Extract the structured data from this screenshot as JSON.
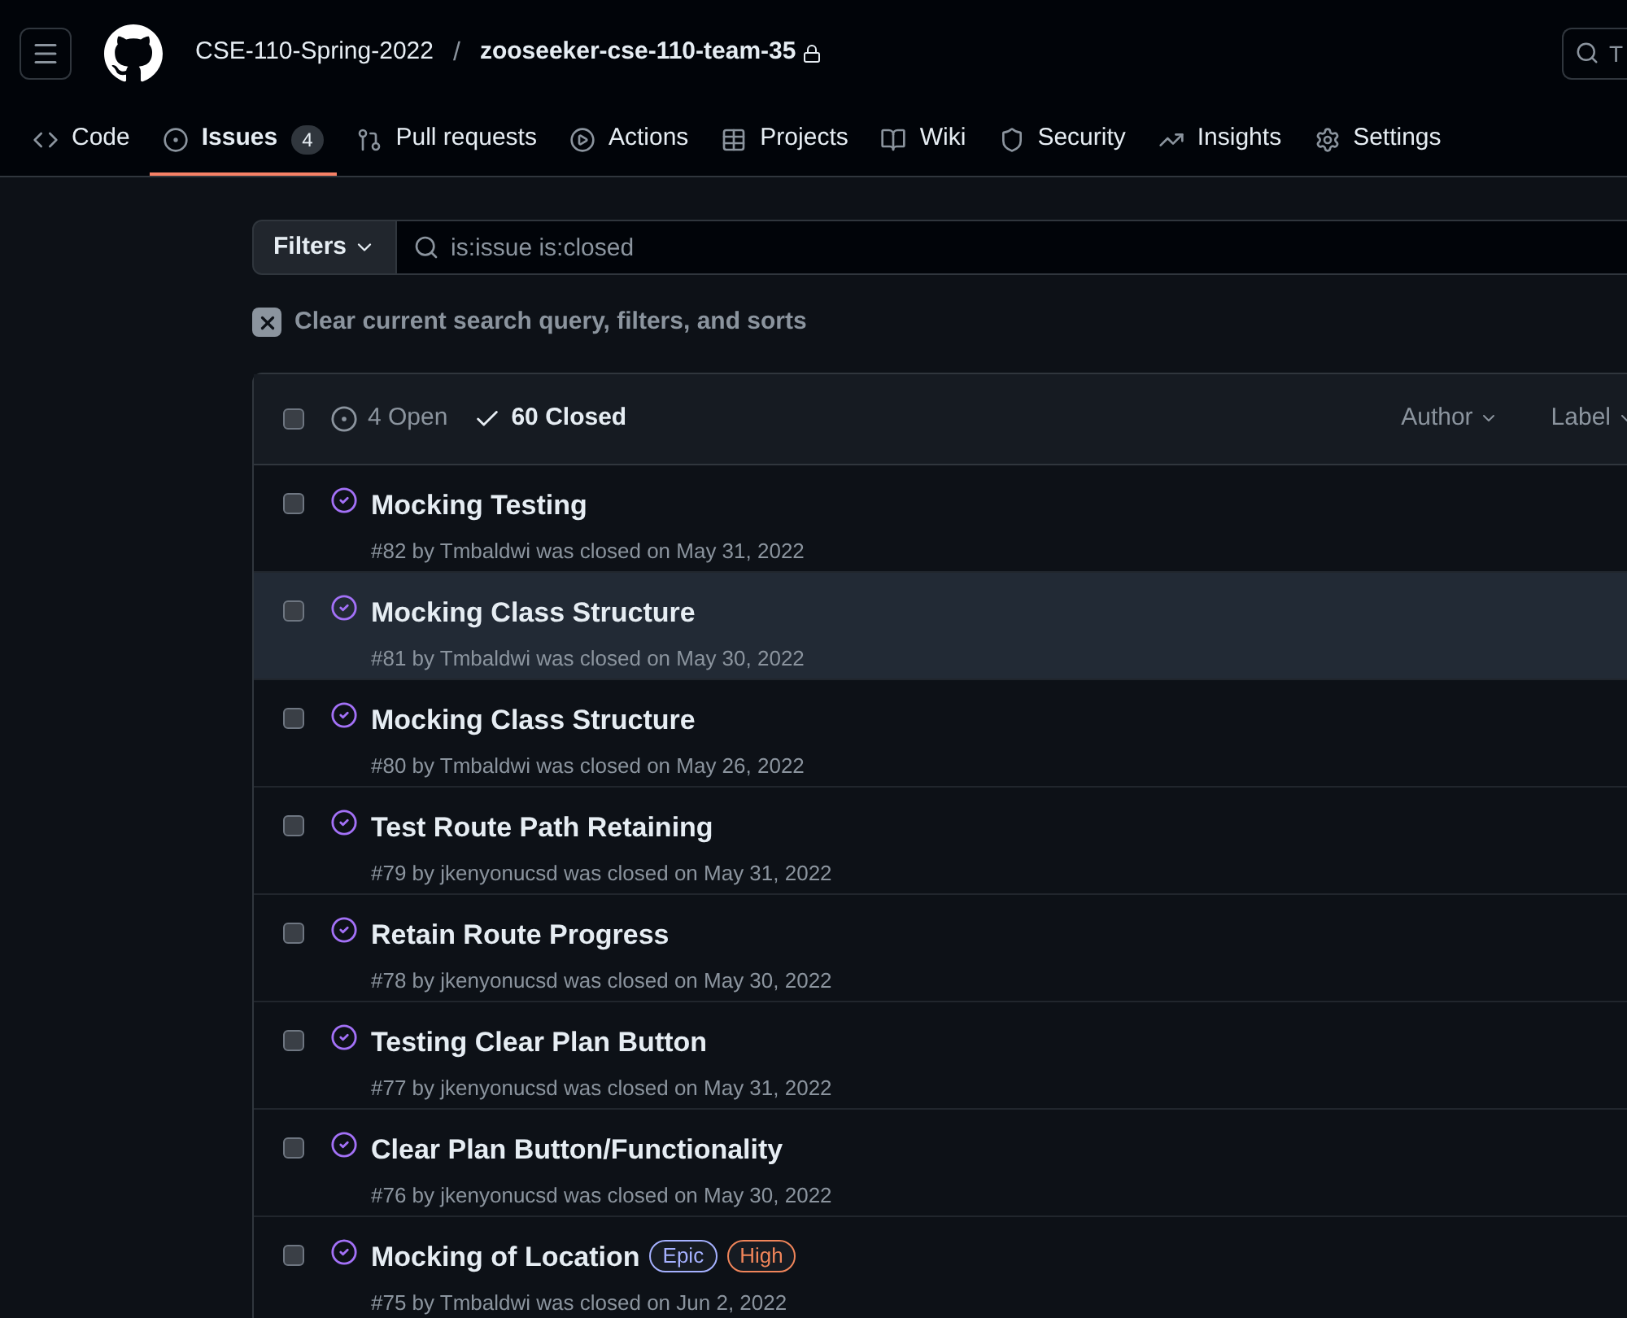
{
  "header": {
    "org": "CSE-110-Spring-2022",
    "separator": "/",
    "repo": "zooseeker-cse-110-team-35",
    "search": {
      "placeholder": "T"
    }
  },
  "tabs": [
    {
      "kind": "code",
      "label": "Code",
      "selected": false
    },
    {
      "kind": "issues",
      "label": "Issues",
      "count": "4",
      "selected": true
    },
    {
      "kind": "pulls",
      "label": "Pull requests",
      "selected": false
    },
    {
      "kind": "actions",
      "label": "Actions",
      "selected": false
    },
    {
      "kind": "projects",
      "label": "Projects",
      "selected": false
    },
    {
      "kind": "wiki",
      "label": "Wiki",
      "selected": false
    },
    {
      "kind": "security",
      "label": "Security",
      "selected": false
    },
    {
      "kind": "insights",
      "label": "Insights",
      "selected": false
    },
    {
      "kind": "settings",
      "label": "Settings",
      "selected": false
    }
  ],
  "filter": {
    "button": "Filters",
    "query": "is:issue is:closed"
  },
  "clear_link": "Clear current search query, filters, and sorts",
  "list_header": {
    "checked": false,
    "states": [
      {
        "kind": "open",
        "label": "4 Open",
        "selected": false
      },
      {
        "kind": "closed",
        "label": "60 Closed",
        "selected": true
      }
    ],
    "menus": [
      "Author",
      "Label"
    ]
  },
  "issues": [
    {
      "title": "Mocking Testing",
      "meta": "#82 by Tmbaldwi was closed on May 31, 2022",
      "checked": false,
      "highlighted": false
    },
    {
      "title": "Mocking Class Structure",
      "meta": "#81 by Tmbaldwi was closed on May 30, 2022",
      "checked": false,
      "highlighted": true
    },
    {
      "title": "Mocking Class Structure",
      "meta": "#80 by Tmbaldwi was closed on May 26, 2022",
      "checked": false,
      "highlighted": false
    },
    {
      "title": "Test Route Path Retaining",
      "meta": "#79 by jkenyonucsd was closed on May 31, 2022",
      "checked": false,
      "highlighted": false
    },
    {
      "title": "Retain Route Progress",
      "meta": "#78 by jkenyonucsd was closed on May 30, 2022",
      "checked": false,
      "highlighted": false
    },
    {
      "title": "Testing Clear Plan Button",
      "meta": "#77 by jkenyonucsd was closed on May 31, 2022",
      "checked": false,
      "highlighted": false
    },
    {
      "title": "Clear Plan Button/Functionality",
      "meta": "#76 by jkenyonucsd was closed on May 30, 2022",
      "checked": false,
      "highlighted": false
    },
    {
      "title": "Mocking of Location",
      "meta": "#75 by Tmbaldwi was closed on Jun 2, 2022",
      "checked": false,
      "highlighted": false,
      "labels": [
        {
          "name": "Epic",
          "color": "#a5b1ff"
        },
        {
          "name": "High",
          "color": "#f0855a"
        }
      ]
    }
  ]
}
